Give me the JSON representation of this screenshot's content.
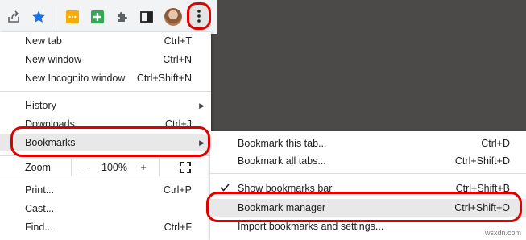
{
  "colors": {
    "highlight_ring": "#e00000",
    "menu_bg": "#ffffff",
    "dark_background": "#4b4a48",
    "star": "#1a73e8",
    "extension_yellow": "#f9ab00",
    "extension_green": "#34a853"
  },
  "toolbar": {
    "icons": [
      "share-icon",
      "bookmark-star-icon",
      "extension-yellow-icon",
      "extension-green-plus-icon",
      "puzzle-extensions-icon",
      "side-panel-icon",
      "profile-avatar",
      "kebab-menu-icon"
    ]
  },
  "main_menu": {
    "new_tab": {
      "label": "New tab",
      "shortcut": "Ctrl+T"
    },
    "new_window": {
      "label": "New window",
      "shortcut": "Ctrl+N"
    },
    "new_incognito": {
      "label": "New Incognito window",
      "shortcut": "Ctrl+Shift+N"
    },
    "history": {
      "label": "History"
    },
    "downloads": {
      "label": "Downloads",
      "shortcut": "Ctrl+J"
    },
    "bookmarks": {
      "label": "Bookmarks"
    },
    "zoom": {
      "label": "Zoom",
      "minus": "–",
      "level": "100%",
      "plus": "+"
    },
    "print": {
      "label": "Print...",
      "shortcut": "Ctrl+P"
    },
    "cast": {
      "label": "Cast..."
    },
    "find": {
      "label": "Find...",
      "shortcut": "Ctrl+F"
    }
  },
  "bookmarks_submenu": {
    "bookmark_this_tab": {
      "label": "Bookmark this tab...",
      "shortcut": "Ctrl+D"
    },
    "bookmark_all_tabs": {
      "label": "Bookmark all tabs...",
      "shortcut": "Ctrl+Shift+D"
    },
    "show_bookmarks_bar": {
      "label": "Show bookmarks bar",
      "shortcut": "Ctrl+Shift+B",
      "checked": true
    },
    "bookmark_manager": {
      "label": "Bookmark manager",
      "shortcut": "Ctrl+Shift+O"
    },
    "import": {
      "label": "Import bookmarks and settings..."
    }
  },
  "watermark": "wsxdn.com"
}
